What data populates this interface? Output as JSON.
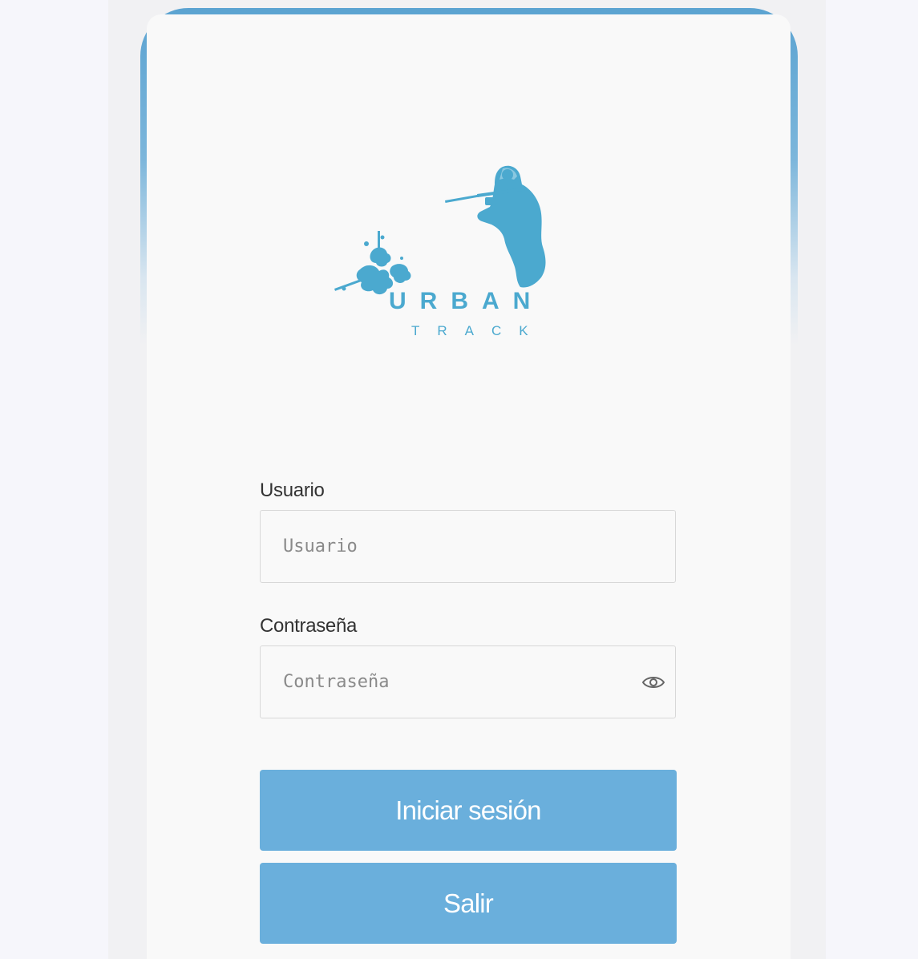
{
  "brand": {
    "name_line1": "URBAN",
    "name_line2": "TRACK",
    "color": "#4ba9cf"
  },
  "form": {
    "username": {
      "label": "Usuario",
      "placeholder": "Usuario",
      "value": ""
    },
    "password": {
      "label": "Contraseña",
      "placeholder": "Contraseña",
      "value": "",
      "toggle_icon": "eye-icon"
    },
    "login_button": "Iniciar sesión",
    "exit_button": "Salir"
  },
  "colors": {
    "accent": "#6aafdc",
    "frame": "#5ba3d1",
    "background": "#f6f6fb",
    "card": "#f9f9f9"
  }
}
